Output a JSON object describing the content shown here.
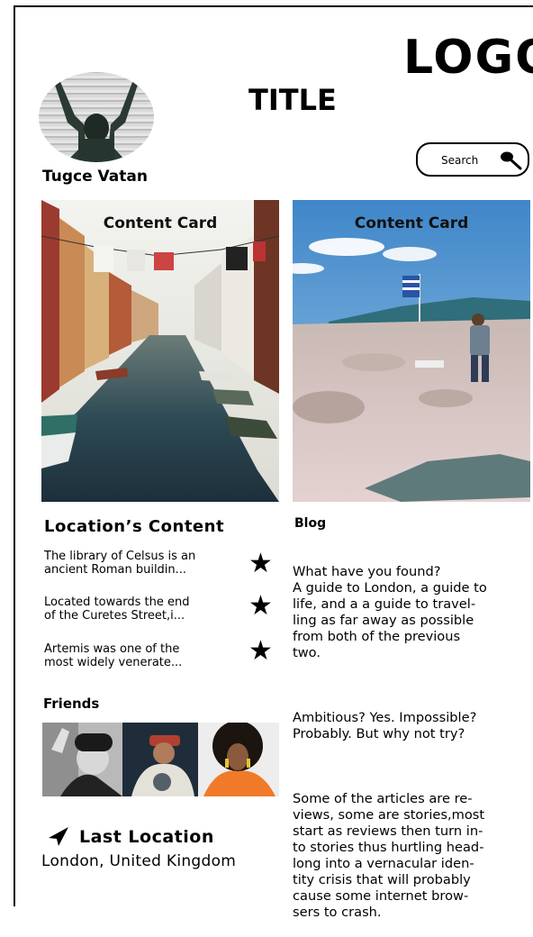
{
  "header": {
    "logo": "LOGO",
    "title": "TITLE"
  },
  "profile": {
    "name": "Tugce Vatan",
    "avatar_icon": "user-photo"
  },
  "search": {
    "label": "Search",
    "icon": "search-icon"
  },
  "cards": [
    {
      "title": "Content Card",
      "image": "venice-canal-photo"
    },
    {
      "title": "Content Card",
      "image": "rocky-beach-flag-photo"
    }
  ],
  "location_content": {
    "heading": "Location’s Content",
    "items": [
      {
        "line1": "The library of Celsus is an",
        "line2": "ancient Roman buildin..."
      },
      {
        "line1": "Located towards the end",
        "line2": "of the Curetes Street,i..."
      },
      {
        "line1": "Artemis was one of the",
        "line2": "most widely venerate..."
      }
    ],
    "item_icon": "star-icon"
  },
  "friends": {
    "heading": "Friends",
    "photos": [
      "friend-1-photo",
      "friend-2-photo",
      "friend-3-photo"
    ]
  },
  "last_location": {
    "label": "Last Location",
    "value": "London, United Kingdom",
    "icon": "location-arrow-icon"
  },
  "blog": {
    "heading": "Blog",
    "paragraphs": [
      "What have you found?\nA guide to London, a guide to\nlife, and a a guide to travel-\nling as far away as possible\nfrom both of the previous\ntwo.",
      "Ambitious? Yes. Impossible?\nProbably. But why not try?",
      "Some of the articles are re-\nviews, some are stories,most\nstart as reviews then turn in-\nto stories thus hurtling head-\nlong into a vernacular iden-\ntity crisis that will probably\ncause some internet brow-\nsers to crash."
    ]
  }
}
